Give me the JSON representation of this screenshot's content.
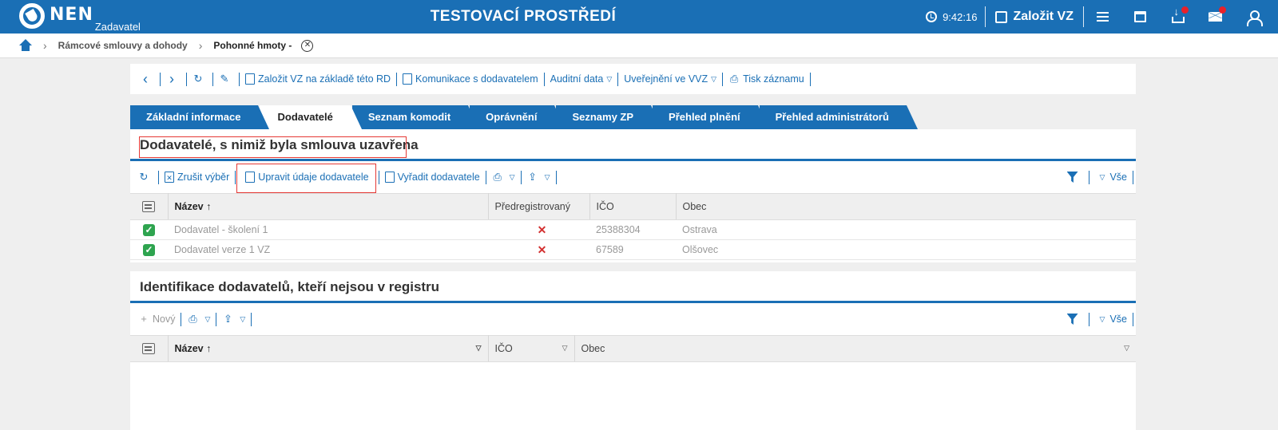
{
  "header": {
    "logo_text": "NEN",
    "logo_sub": "Zadavatel",
    "env_title": "TESTOVACÍ PROSTŘEDÍ",
    "time": "9:42:16",
    "create_vz": "Založit VZ"
  },
  "breadcrumb": {
    "items": [
      "Rámcové smlouvy a dohody",
      "Pohonné hmoty -"
    ]
  },
  "toolbar": {
    "create_vz_rd": "Založit VZ na základě této RD",
    "komunikace": "Komunikace s dodavatelem",
    "auditni": "Auditní data",
    "uverejneni": "Uveřejnění ve VVZ",
    "tisk": "Tisk záznamu"
  },
  "tabs": [
    {
      "label": "Základní informace"
    },
    {
      "label": "Dodavatelé"
    },
    {
      "label": "Seznam komodit"
    },
    {
      "label": "Oprávnění"
    },
    {
      "label": "Seznamy ZP"
    },
    {
      "label": "Přehled plnění"
    },
    {
      "label": "Přehled administrátorů"
    }
  ],
  "section1": {
    "title": "Dodavatelé, s nimiž byla smlouva uzavřena",
    "zrusit": "Zrušit výběr",
    "upravit": "Upravit údaje dodavatele",
    "vyradit": "Vyřadit dodavatele",
    "vse": "Vše",
    "columns": [
      "Název",
      "Předregistrovaný",
      "IČO",
      "Obec"
    ],
    "rows": [
      {
        "nazev": "Dodavatel - školení 1",
        "ico": "25388304",
        "obec": "Ostrava"
      },
      {
        "nazev": "Dodavatel verze 1 VZ",
        "ico": "67589",
        "obec": "Olšovec"
      }
    ]
  },
  "section2": {
    "title": "Identifikace dodavatelů, kteří nejsou v registru",
    "novy": "Nový",
    "vse": "Vše",
    "columns": [
      "Název",
      "IČO",
      "Obec"
    ]
  }
}
